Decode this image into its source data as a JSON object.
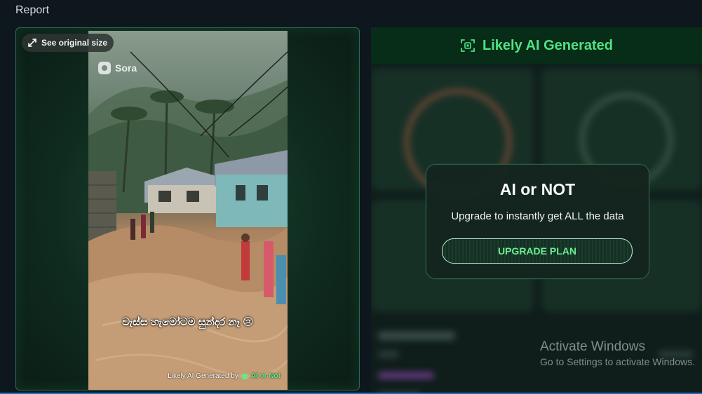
{
  "page": {
    "title": "Report"
  },
  "image_card": {
    "see_original_label": "See original size",
    "video": {
      "logo_text": "Sora",
      "subtitle": "වැස්ස හැමෝටම සුන්දර නෑ 😢",
      "watermark_prefix": "Likely AI Generated by",
      "watermark_brand": "AI or Not"
    }
  },
  "result": {
    "verdict": "Likely AI Generated",
    "verdict_color": "#4fe383"
  },
  "upgrade_modal": {
    "title": "AI or NOT",
    "message": "Upgrade to instantly get ALL the data",
    "button_label": "UPGRADE PLAN"
  },
  "os_overlay": {
    "title": "Activate Windows",
    "subtitle": "Go to Settings to activate Windows."
  }
}
